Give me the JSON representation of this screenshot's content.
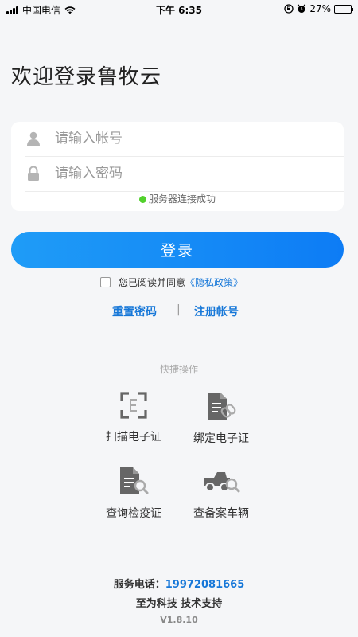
{
  "status_bar": {
    "carrier": "中国电信",
    "time": "下午 6:35",
    "battery": "27%",
    "battery_level": 0.27
  },
  "header": {
    "welcome": "欢迎登录鲁牧云"
  },
  "login_form": {
    "account_placeholder": "请输入帐号",
    "account_value": "",
    "password_placeholder": "请输入密码",
    "password_value": "",
    "server_status": "服务器连接成功",
    "server_status_color": "#52d12c",
    "login_label": "登录",
    "agree_text": "您已阅读并同意",
    "privacy_link": "《隐私政策》",
    "agree_checked": false,
    "reset_password": "重置密码",
    "separator": "|",
    "register": "注册帐号"
  },
  "quick_actions": {
    "title": "快捷操作",
    "items": [
      {
        "label": "扫描电子证",
        "icon": "scan-icon"
      },
      {
        "label": "绑定电子证",
        "icon": "bind-document-icon"
      },
      {
        "label": "查询检疫证",
        "icon": "search-document-icon"
      },
      {
        "label": "查备案车辆",
        "icon": "vehicle-search-icon"
      }
    ]
  },
  "footer": {
    "phone_label": "服务电话：",
    "phone_number": "19972081665",
    "support": "至为科技 技术支持",
    "version": "V1.8.10"
  },
  "colors": {
    "accent": "#1677d8",
    "button_start": "#1f9cf7",
    "button_end": "#0d7cf5",
    "background": "#f5f6f8"
  }
}
